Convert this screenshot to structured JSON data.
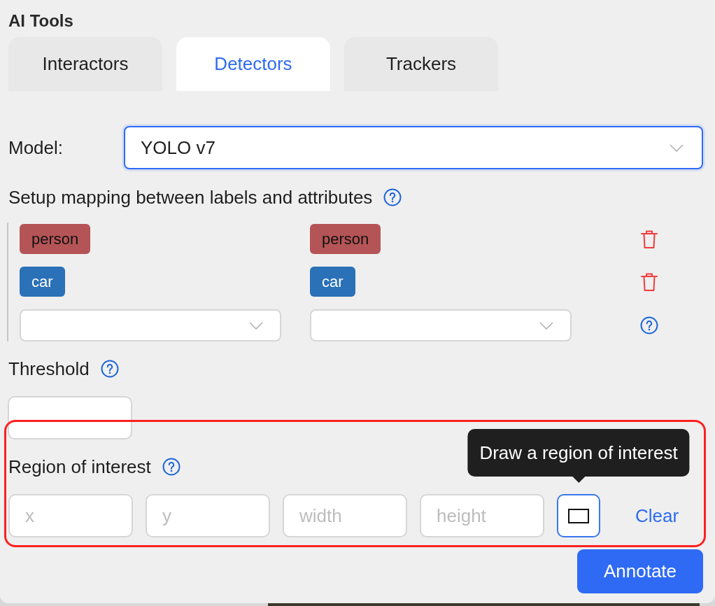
{
  "panel": {
    "title": "AI Tools"
  },
  "tabs": [
    {
      "label": "Interactors",
      "selected": false
    },
    {
      "label": "Detectors",
      "selected": true
    },
    {
      "label": "Trackers",
      "selected": false
    }
  ],
  "model": {
    "label": "Model:",
    "value": "YOLO v7"
  },
  "mapping": {
    "heading": "Setup mapping between labels and attributes",
    "rows": [
      {
        "kind": "pair",
        "model_label": {
          "text": "person",
          "color": "#b55456",
          "light_text": false
        },
        "task_label": {
          "text": "person",
          "color": "#b55456",
          "light_text": false
        }
      },
      {
        "kind": "pair",
        "model_label": {
          "text": "car",
          "color": "#2b71b7",
          "light_text": true
        },
        "task_label": {
          "text": "car",
          "color": "#2b71b7",
          "light_text": true
        }
      },
      {
        "kind": "new"
      }
    ]
  },
  "threshold": {
    "label": "Threshold"
  },
  "region_of_interest": {
    "label": "Region of interest",
    "highlighted": true,
    "fields": [
      {
        "placeholder": "x"
      },
      {
        "placeholder": "y"
      },
      {
        "placeholder": "width"
      },
      {
        "placeholder": "height"
      }
    ],
    "draw_button": {
      "hovered": true,
      "tooltip": "Draw a region of interest"
    },
    "clear": "Clear"
  },
  "annotate_button": "Annotate"
}
